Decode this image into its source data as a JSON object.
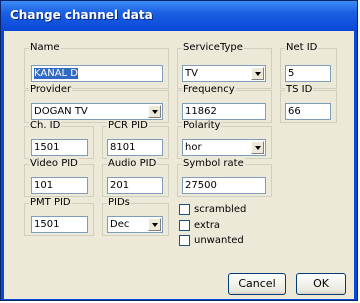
{
  "window": {
    "title": "Change channel data"
  },
  "fields": {
    "name": {
      "label": "Name",
      "value": "KANAL D"
    },
    "service_type": {
      "label": "ServiceType",
      "value": "TV"
    },
    "net_id": {
      "label": "Net ID",
      "value": "5"
    },
    "provider": {
      "label": "Provider",
      "value": "DOGAN TV"
    },
    "frequency": {
      "label": "Frequency",
      "value": "11862"
    },
    "ts_id": {
      "label": "TS ID",
      "value": "66"
    },
    "ch_id": {
      "label": "Ch. ID",
      "value": "1501"
    },
    "pcr_pid": {
      "label": "PCR PID",
      "value": "8101"
    },
    "polarity": {
      "label": "Polarity",
      "value": "hor"
    },
    "video_pid": {
      "label": "Video PID",
      "value": "101"
    },
    "audio_pid": {
      "label": "Audio PID",
      "value": "201"
    },
    "symbol_rate": {
      "label": "Symbol rate",
      "value": "27500"
    },
    "pmt_pid": {
      "label": "PMT PID",
      "value": "1501"
    },
    "pids": {
      "label": "PIDs",
      "value": "Dec"
    }
  },
  "checkboxes": [
    {
      "label": "scrambled",
      "checked": false
    },
    {
      "label": "extra",
      "checked": false
    },
    {
      "label": "unwanted",
      "checked": false
    }
  ],
  "buttons": {
    "cancel": "Cancel",
    "ok": "OK"
  }
}
